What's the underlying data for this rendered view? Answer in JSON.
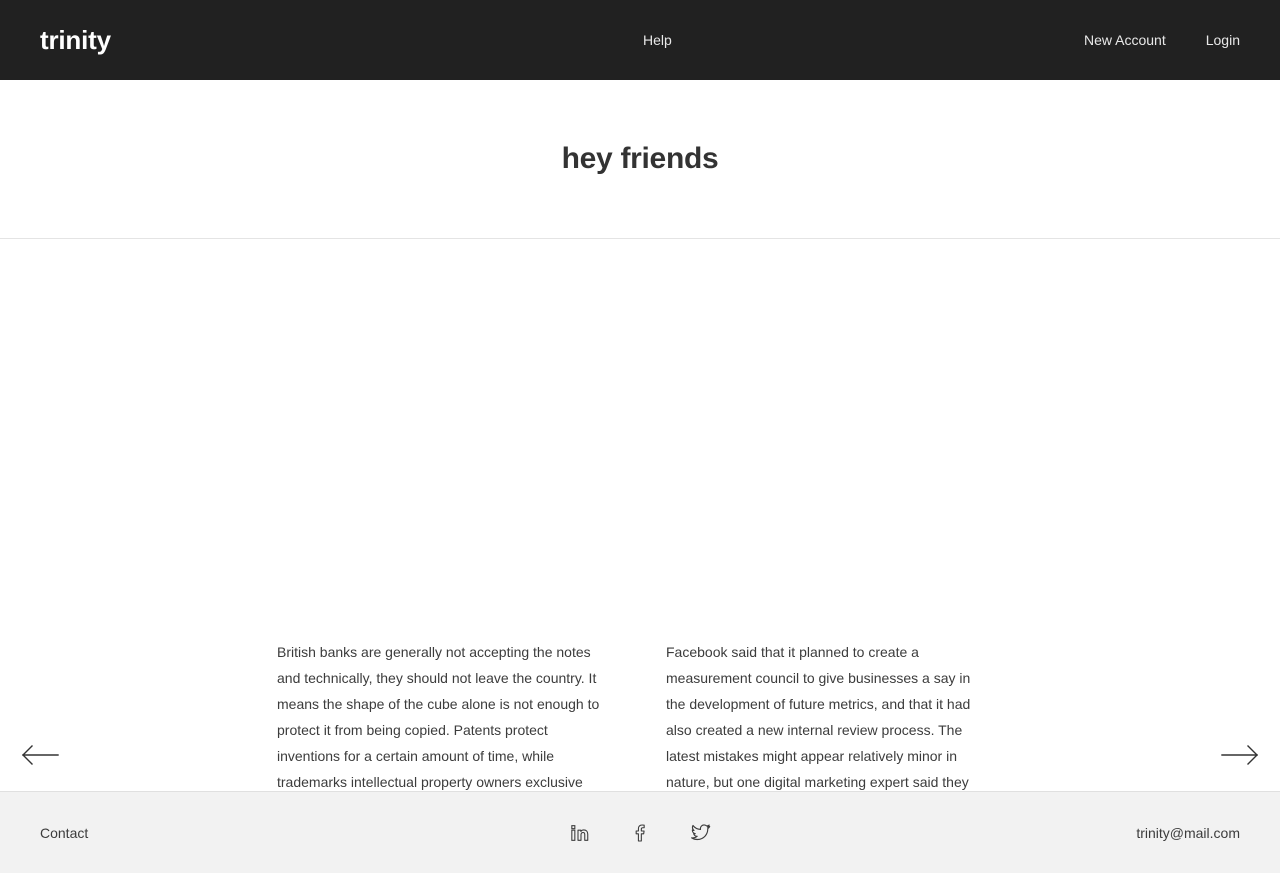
{
  "header": {
    "brand": "trinity",
    "center_nav": [
      {
        "label": "Help",
        "icon": "help-link"
      }
    ],
    "right_nav": [
      {
        "label": "New Account"
      },
      {
        "label": "Login"
      }
    ],
    "background_color": "#212121",
    "text_color": "#e8e8e8"
  },
  "hero": {
    "title": "hey friends"
  },
  "carousel": {
    "prev_icon": "arrow-left-icon",
    "next_icon": "arrow-right-icon",
    "columns": [
      {
        "text": "British banks are generally not accepting the notes and technically, they should not leave the country. It means the shape of the cube alone is not enough to protect it from being copied. Patents protect inventions for a certain amount of time, while trademarks intellectual property owners exclusive rights to their designs."
      },
      {
        "text": "Facebook said that it planned to create a measurement council to give businesses a say in the development of future metrics, and that it had also created a new internal review process. The latest mistakes might appear relatively minor in nature, but one digital marketing expert said they undermined confidence in the social network."
      }
    ]
  },
  "cta": {
    "label": "new account",
    "color": "#03a9f4"
  },
  "footer": {
    "contact_label": "Contact",
    "email": "trinity@mail.com",
    "background_color": "#f2f2f2",
    "social": [
      {
        "name": "linkedin-icon"
      },
      {
        "name": "facebook-icon"
      },
      {
        "name": "twitter-icon"
      }
    ]
  }
}
